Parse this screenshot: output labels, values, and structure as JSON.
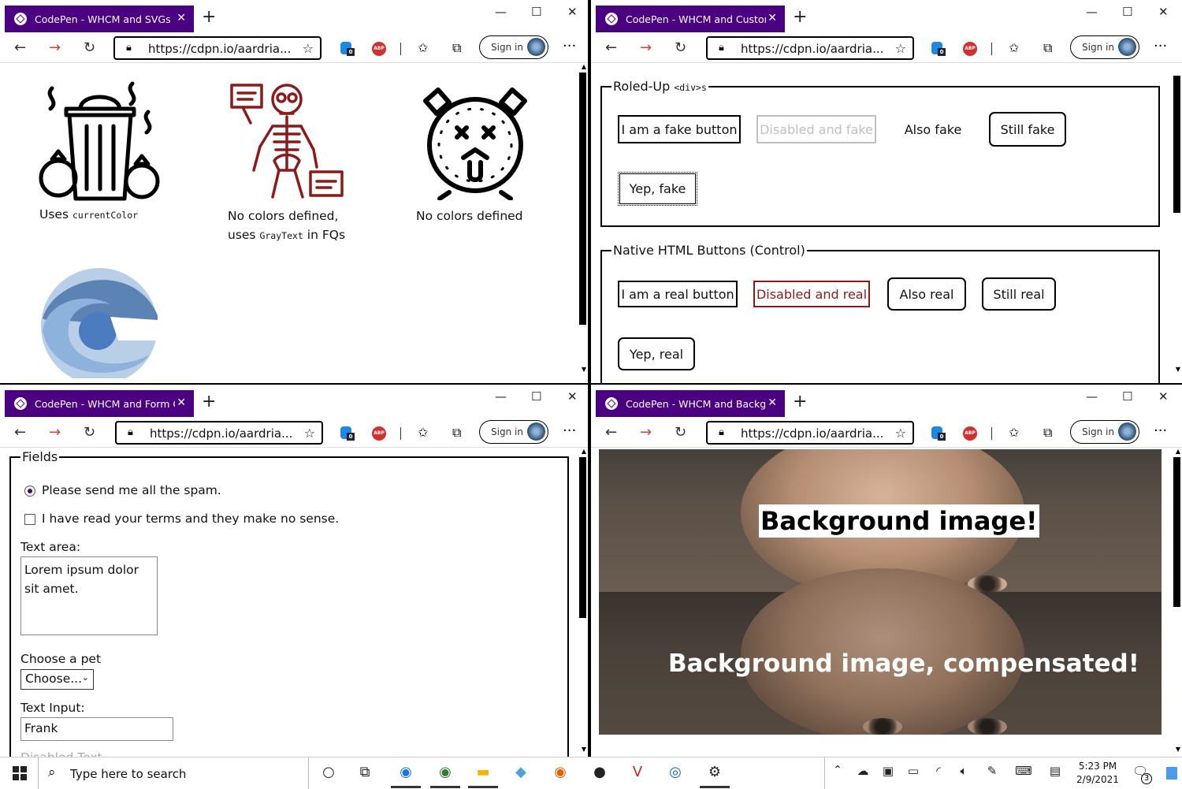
{
  "browser": {
    "url": "https://cdpn.io/aardria...",
    "sign_in": "Sign in",
    "more": "···",
    "badge": "0",
    "abp": "ABP"
  },
  "windows": [
    {
      "tab_title": "CodePen - WHCM and SVGs"
    },
    {
      "tab_title": "CodePen - WHCM and Custom E"
    },
    {
      "tab_title": "CodePen - WHCM and Form Co"
    },
    {
      "tab_title": "CodePen - WHCM and Backgrou"
    }
  ],
  "svgs": {
    "cap1_pre": "Uses ",
    "cap1_code": "currentColor",
    "cap2_line1": "No colors defined,",
    "cap2_pre": "uses ",
    "cap2_code": "GrayText",
    "cap2_post": " in FQs",
    "cap3": "No colors defined"
  },
  "custom": {
    "legend1_text": "Roled-Up ",
    "legend1_code": "<div>s",
    "fake_buttons": [
      "I am a fake button",
      "Disabled and fake",
      "Also fake",
      "Still fake",
      "Yep, fake"
    ],
    "legend2": "Native HTML Buttons (Control)",
    "real_buttons": [
      "I am a real button",
      "Disabled and real",
      "Also real",
      "Still real",
      "Yep, real"
    ]
  },
  "form": {
    "legend": "Fields",
    "radio_label": "Please send me all the spam.",
    "checkbox_label": "I have read your terms and they make no sense.",
    "textarea_label": "Text area:",
    "textarea_value": "Lorem ipsum dolor sit amet.",
    "select_label": "Choose a pet",
    "select_value": "Choose...",
    "input_label": "Text Input:",
    "input_value": "Frank",
    "cut_label": "Disabled Text"
  },
  "background": {
    "text1": "Background image!",
    "text2": "Background image, compensated!"
  },
  "taskbar": {
    "search_placeholder": "Type here to search",
    "time": "5:23 PM",
    "date": "2/9/2021",
    "notifications": "3"
  },
  "colors": {
    "tab_bg": "#4b0082",
    "forward_arrow": "#e03c31",
    "disabled_real": "#8b1a1a",
    "disabled_fake": "#c0c0c0"
  }
}
